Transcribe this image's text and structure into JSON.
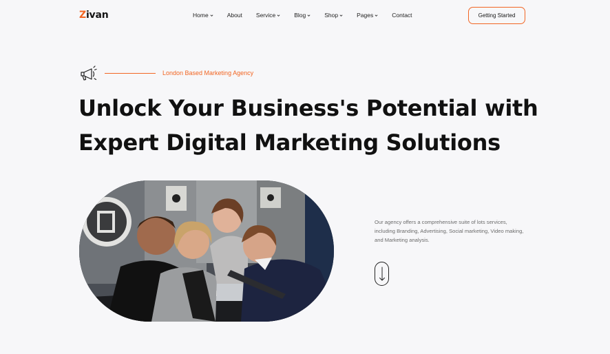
{
  "brand": {
    "first_letter": "Z",
    "rest": "ivan"
  },
  "nav": {
    "items": [
      {
        "label": "Home",
        "has_dropdown": true
      },
      {
        "label": "About",
        "has_dropdown": false
      },
      {
        "label": "Service",
        "has_dropdown": true
      },
      {
        "label": "Blog",
        "has_dropdown": true
      },
      {
        "label": "Shop",
        "has_dropdown": true
      },
      {
        "label": "Pages",
        "has_dropdown": true
      },
      {
        "label": "Contact",
        "has_dropdown": false
      }
    ],
    "cta_label": "Getting Started"
  },
  "hero": {
    "icon": "megaphone-icon",
    "tagline": "London Based Marketing Agency",
    "headline_line1": "Unlock Your Business's Potential with",
    "headline_line2": "Expert Digital Marketing Solutions",
    "description": "Our agency offers a comprehensive suite of lots services, including Branding, Advertising, Social marketing, Video making, and Marketing analysis.",
    "scroll_icon": "arrow-down-icon"
  },
  "colors": {
    "accent": "#f26522",
    "text": "#151515",
    "background": "#f7f7f9"
  }
}
